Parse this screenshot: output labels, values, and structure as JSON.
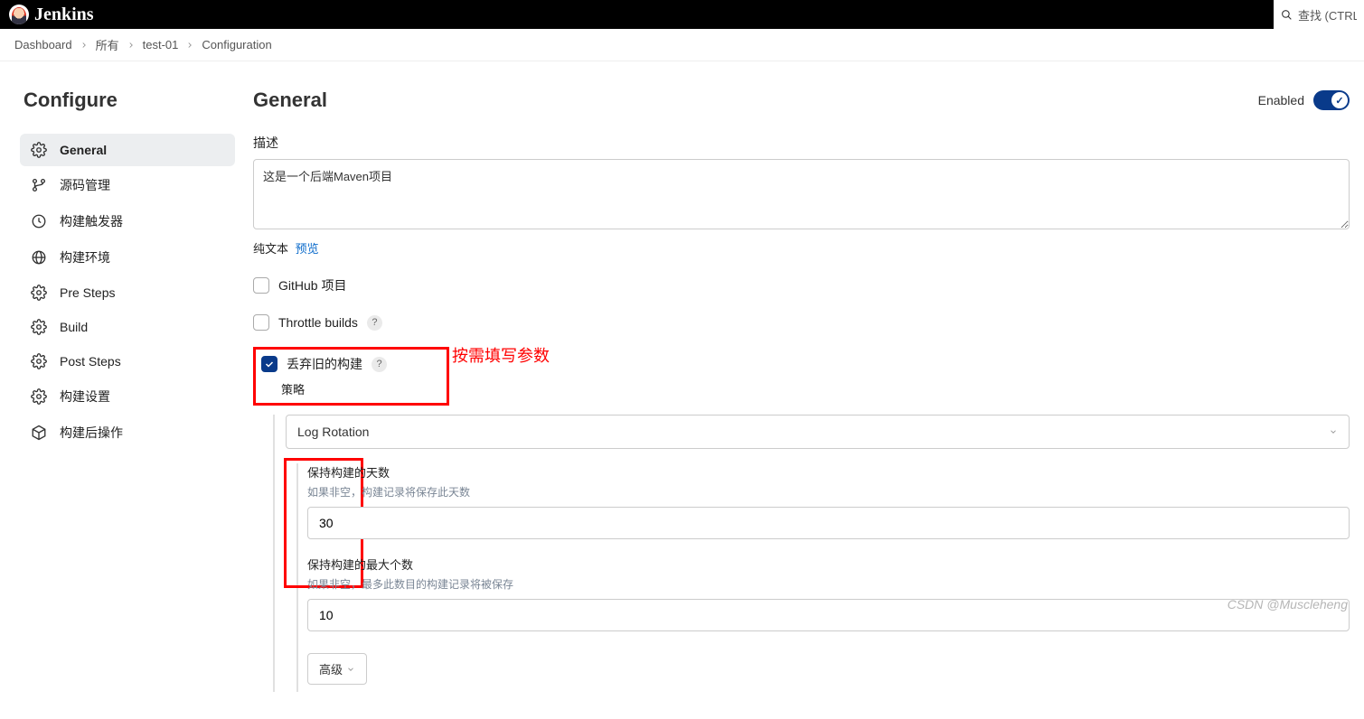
{
  "header": {
    "app_name": "Jenkins",
    "search_placeholder": "查找 (CTRL+"
  },
  "breadcrumbs": [
    "Dashboard",
    "所有",
    "test-01",
    "Configuration"
  ],
  "sidebar": {
    "title": "Configure",
    "items": [
      {
        "icon": "gear",
        "label": "General",
        "active": true
      },
      {
        "icon": "branch",
        "label": "源码管理",
        "active": false
      },
      {
        "icon": "clock",
        "label": "构建触发器",
        "active": false
      },
      {
        "icon": "globe",
        "label": "构建环境",
        "active": false
      },
      {
        "icon": "gear",
        "label": "Pre Steps",
        "active": false
      },
      {
        "icon": "gear",
        "label": "Build",
        "active": false
      },
      {
        "icon": "gear",
        "label": "Post Steps",
        "active": false
      },
      {
        "icon": "gear",
        "label": "构建设置",
        "active": false
      },
      {
        "icon": "cube",
        "label": "构建后操作",
        "active": false
      }
    ]
  },
  "main": {
    "title": "General",
    "enabled_label": "Enabled",
    "desc_label": "描述",
    "desc_value": "这是一个后端Maven项目",
    "helper_plain": "纯文本",
    "helper_preview": "预览",
    "github_label": "GitHub 项目",
    "throttle_label": "Throttle builds",
    "discard_label": "丢弃旧的构建",
    "annotation": "按需填写参数",
    "strategy_label": "策略",
    "strategy_value": "Log Rotation",
    "days_label": "保持构建的天数",
    "days_help": "如果非空，构建记录将保存此天数",
    "days_value": "30",
    "max_label": "保持构建的最大个数",
    "max_help": "如果非空，最多此数目的构建记录将被保存",
    "max_value": "10",
    "advanced_btn": "高级"
  },
  "watermark": "CSDN @Muscleheng"
}
